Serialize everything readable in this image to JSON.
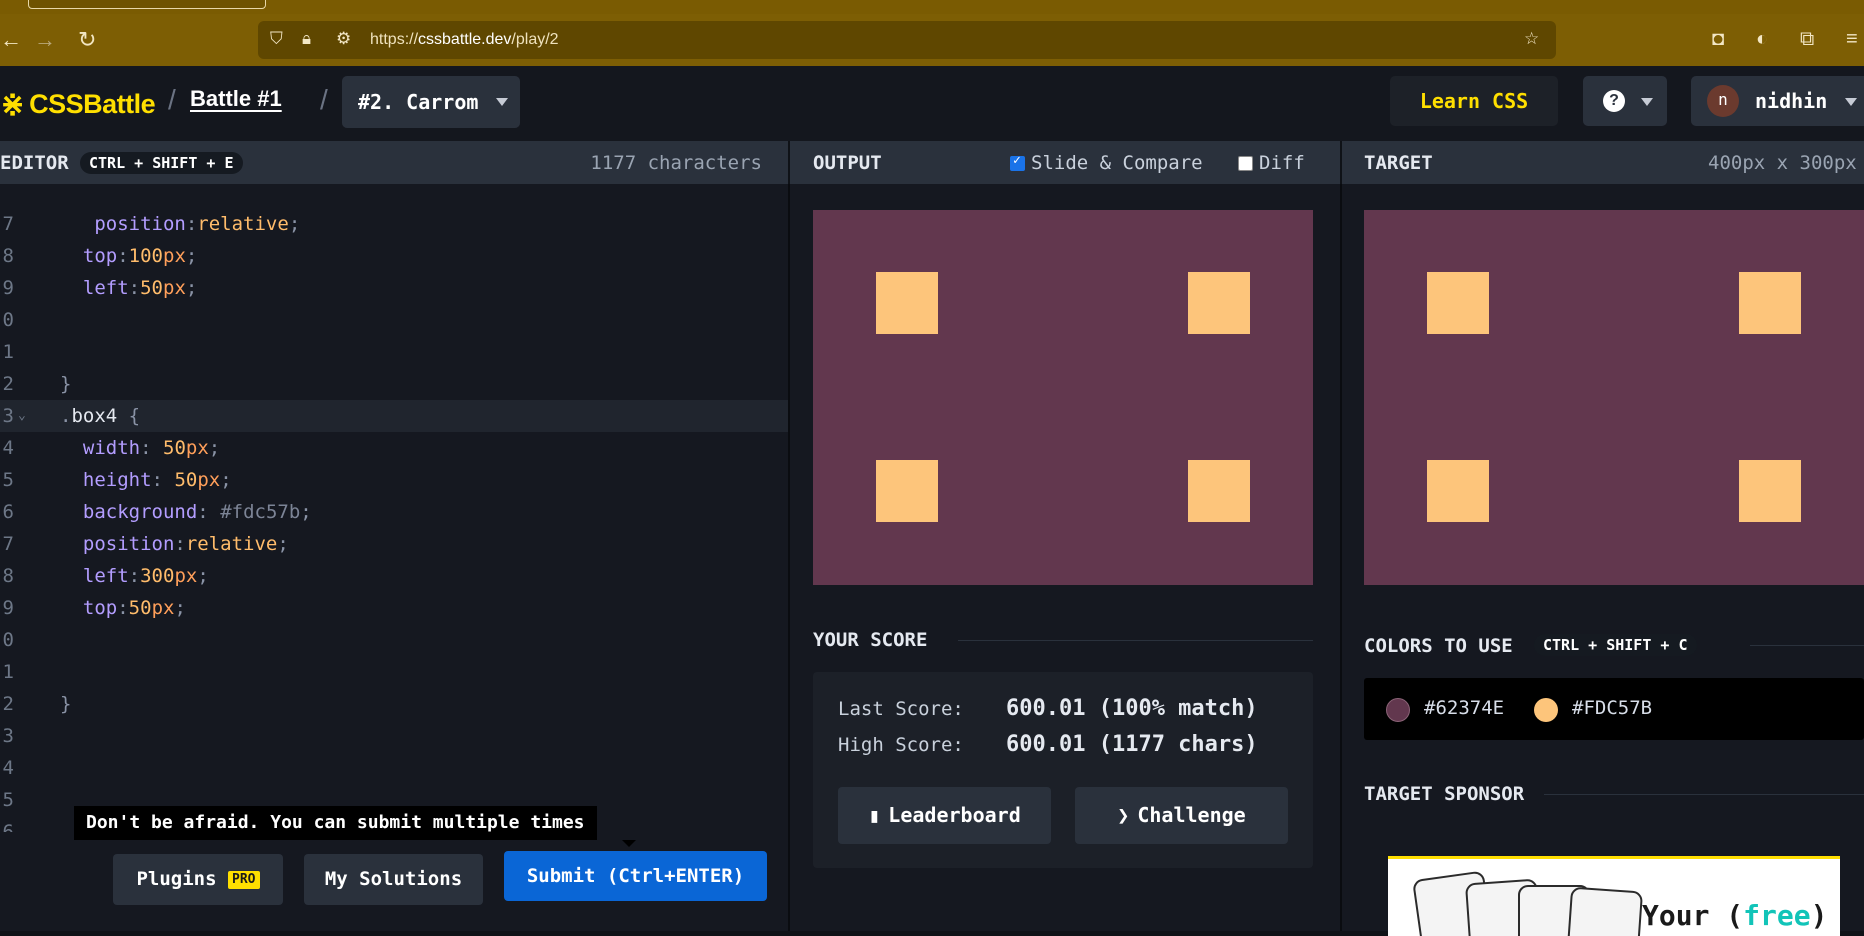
{
  "browser": {
    "url_prefix": "https://",
    "url_domain": "cssbattle.dev",
    "url_path": "/play/2"
  },
  "header": {
    "logo_text": "CSSBattle",
    "breadcrumb_sep": "/",
    "battle_link": "Battle #1",
    "target_select": "#2. Carrom",
    "learn_css": "Learn CSS",
    "help": "?",
    "user_initial": "n",
    "user_name": "nidhin"
  },
  "editor": {
    "title": "EDITOR",
    "shortcut": "CTRL + SHIFT + E",
    "char_count": "1177 characters",
    "line_numbers": [
      "7",
      "8",
      "9",
      "0",
      "1",
      "2",
      "3",
      "4",
      "5",
      "6",
      "7",
      "8",
      "9",
      "0",
      "1",
      "2",
      "3",
      "4",
      "5",
      "6"
    ],
    "tooltip": "Don't be afraid. You can submit multiple times",
    "plugins_label": "Plugins",
    "pro_badge": "PRO",
    "solutions_label": "My Solutions",
    "submit_label": "Submit (Ctrl+ENTER)"
  },
  "output": {
    "title": "OUTPUT",
    "slide_compare": "Slide & Compare",
    "slide_compare_checked": true,
    "diff": "Diff",
    "diff_checked": false,
    "your_score_title": "YOUR SCORE",
    "last_score_label": "Last Score:",
    "last_score_value": "600.01 (100% match)",
    "high_score_label": "High Score:",
    "high_score_value": "600.01 (1177 chars)",
    "leaderboard_label": "Leaderboard",
    "challenge_label": "Challenge"
  },
  "target": {
    "title": "TARGET",
    "size": "400px x 300px",
    "colors_title": "COLORS TO USE",
    "colors_shortcut": "CTRL + SHIFT + C",
    "colors": [
      {
        "hex": "#62374E",
        "color": "#62374e"
      },
      {
        "hex": "#FDC57B",
        "color": "#fdc57b"
      }
    ],
    "sponsor_title": "TARGET SPONSOR",
    "sponsor_text_1": "Your (",
    "sponsor_text_2": "free",
    "sponsor_text_3": ")"
  },
  "theme": {
    "brand": "#ffdf00",
    "canvas_bg": "#62374e",
    "box_color": "#fdc57b",
    "submit_blue": "#0a66d6"
  }
}
